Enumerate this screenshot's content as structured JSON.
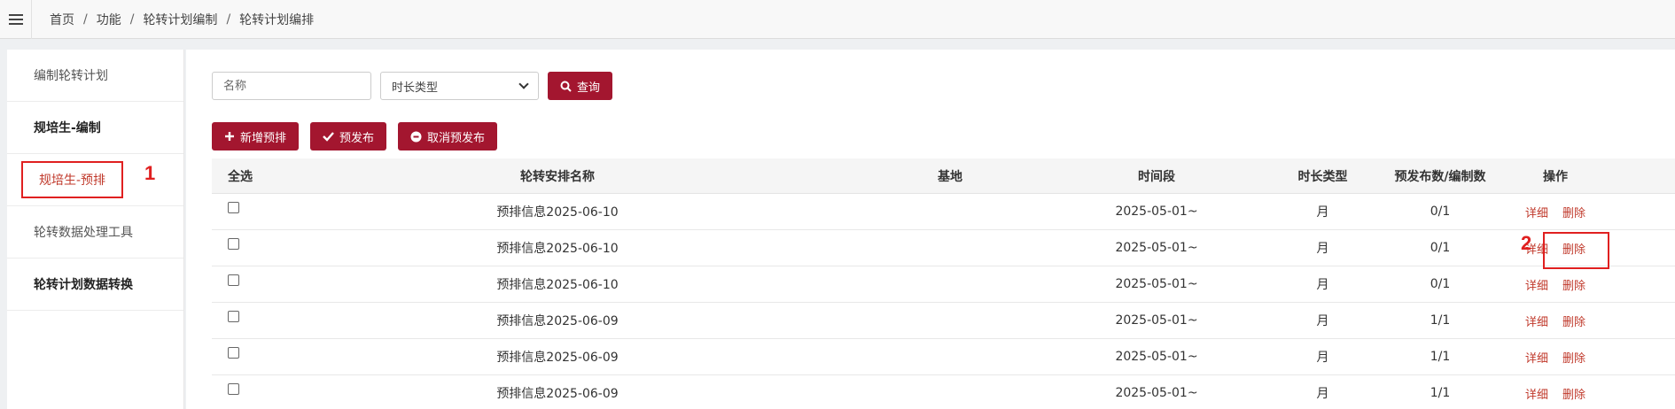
{
  "breadcrumb": [
    "首页",
    "功能",
    "轮转计划编制",
    "轮转计划编排"
  ],
  "breadcrumb_sep": "/",
  "sidebar": {
    "items": [
      {
        "label": "编制轮转计划"
      },
      {
        "label": "规培生-编制"
      },
      {
        "label": "规培生-预排"
      },
      {
        "label": "轮转数据处理工具"
      },
      {
        "label": "轮转计划数据转换"
      }
    ]
  },
  "annotations": {
    "one": "1",
    "two": "2"
  },
  "search": {
    "name_placeholder": "名称",
    "type_selected": "时长类型",
    "query_label": "查询"
  },
  "toolbar": {
    "add_label": "新增预排",
    "publish_label": "预发布",
    "cancel_label": "取消预发布"
  },
  "icons": {
    "menu": "hamburger-icon",
    "query": "search-icon",
    "add": "plus-icon",
    "publish": "check-icon",
    "cancel": "minus-circle-icon"
  },
  "colors": {
    "accent": "#a3162f",
    "link": "#c0392b",
    "annotation": "#e02020"
  },
  "table": {
    "headers": {
      "select_all": "全选",
      "name": "轮转安排名称",
      "base": "基地",
      "period": "时间段",
      "type": "时长类型",
      "count": "预发布数/编制数",
      "ops": "操作"
    },
    "detail_label": "详细",
    "delete_label": "删除",
    "rows": [
      {
        "name": "预排信息2025-06-10",
        "base": "",
        "period": "2025-05-01~",
        "type": "月",
        "count": "0/1"
      },
      {
        "name": "预排信息2025-06-10",
        "base": "",
        "period": "2025-05-01~",
        "type": "月",
        "count": "0/1"
      },
      {
        "name": "预排信息2025-06-10",
        "base": "",
        "period": "2025-05-01~",
        "type": "月",
        "count": "0/1"
      },
      {
        "name": "预排信息2025-06-09",
        "base": "",
        "period": "2025-05-01~",
        "type": "月",
        "count": "1/1"
      },
      {
        "name": "预排信息2025-06-09",
        "base": "",
        "period": "2025-05-01~",
        "type": "月",
        "count": "1/1"
      },
      {
        "name": "预排信息2025-06-09",
        "base": "",
        "period": "2025-05-01~",
        "type": "月",
        "count": "1/1"
      }
    ]
  }
}
